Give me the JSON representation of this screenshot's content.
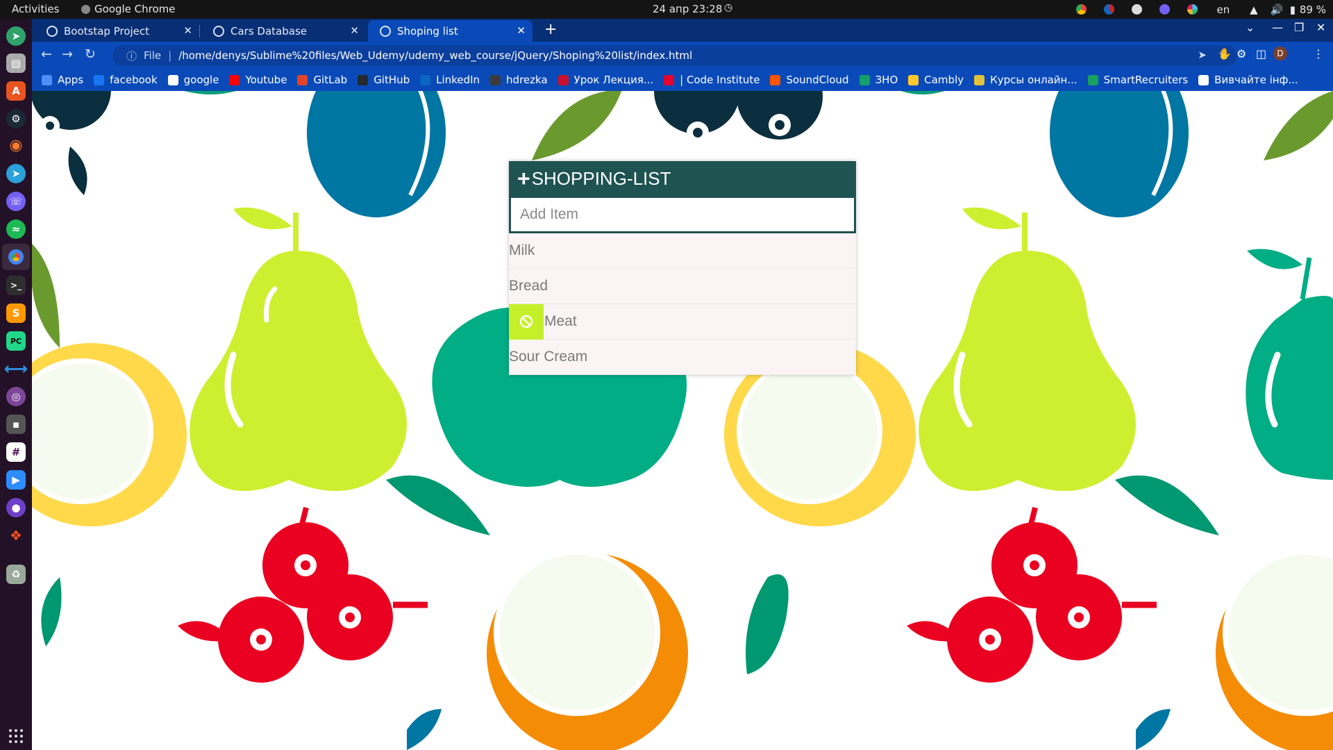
{
  "topbar": {
    "activities": "Activities",
    "app_name": "Google Chrome",
    "datetime": "24 апр  23:28",
    "lang": "en",
    "battery": "89 %"
  },
  "tabs": [
    {
      "title": "Bootstap Project",
      "active": false
    },
    {
      "title": "Cars Database",
      "active": false
    },
    {
      "title": "Shoping list",
      "active": true
    }
  ],
  "toolbar": {
    "file_label": "File",
    "url": "/home/denys/Sublime%20files/Web_Udemy/udemy_web_course/jQuery/Shoping%20list/index.html",
    "profile_initial": "D"
  },
  "bookmarks": [
    {
      "label": "Apps",
      "color": "#4f8ef7"
    },
    {
      "label": "facebook",
      "color": "#1877f2"
    },
    {
      "label": "google",
      "color": "#ffffff"
    },
    {
      "label": "Youtube",
      "color": "#ff0000"
    },
    {
      "label": "GitLab",
      "color": "#e24329"
    },
    {
      "label": "GitHub",
      "color": "#24292e"
    },
    {
      "label": "LinkedIn",
      "color": "#0a66c2"
    },
    {
      "label": "hdrezka",
      "color": "#3b3b3b"
    },
    {
      "label": "Урок Лекция...",
      "color": "#c8102e"
    },
    {
      "label": "| Code Institute",
      "color": "#e4032e"
    },
    {
      "label": "SoundCloud",
      "color": "#ff5500"
    },
    {
      "label": "ЗНО",
      "color": "#15a06b"
    },
    {
      "label": "Cambly",
      "color": "#ffc72c"
    },
    {
      "label": "Курсы онлайн...",
      "color": "#e0c23a"
    },
    {
      "label": "SmartRecruiters",
      "color": "#18a05e"
    },
    {
      "label": "Вивчайте інф...",
      "color": "#ffffff"
    }
  ],
  "shopping_list": {
    "title": "SHOPPING-LIST",
    "plus_symbol": "+",
    "input_placeholder": "Add Item",
    "items": [
      {
        "text": "Milk",
        "hover": false
      },
      {
        "text": "Bread",
        "hover": false
      },
      {
        "text": "Meat",
        "hover": true
      },
      {
        "text": "Sour Cream",
        "hover": false
      }
    ]
  },
  "colors": {
    "header_bg": "#1e5351",
    "item_bg": "#fbf4f4",
    "delete_bg": "#c5ef29",
    "chrome_bg": "#0a4ab8"
  }
}
